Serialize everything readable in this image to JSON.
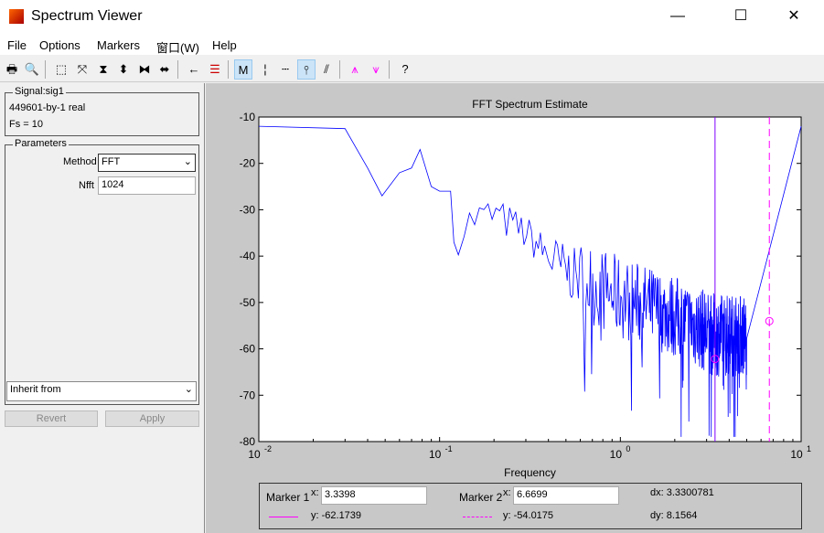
{
  "window": {
    "title": "Spectrum Viewer",
    "minimize": "—",
    "maximize": "☐",
    "close": "✕"
  },
  "menu": [
    "File",
    "Options",
    "Markers",
    "窗口(W)",
    "Help"
  ],
  "toolbar": [
    "printer-icon",
    "print-preview-icon",
    "zoom-box-icon",
    "zoom-out-icon",
    "vertical-zoom-in-icon",
    "vertical-zoom-out-icon",
    "horizontal-zoom-in-icon",
    "horizontal-zoom-out-icon",
    "select-signal-icon",
    "line-style-icon",
    "markers-on-off-icon",
    "vertical-markers-icon",
    "horizontal-markers-icon",
    "track-markers-icon",
    "slope-markers-icon",
    "peaks-icon",
    "valleys-icon",
    "whats-this-icon"
  ],
  "signal": {
    "legend": "Signal:sig1",
    "size": "449601-by-1 real",
    "fs": "Fs = 10"
  },
  "parameters": {
    "legend": "Parameters",
    "method_label": "Method",
    "method": "FFT",
    "nfft_label": "Nfft",
    "nfft": "1024",
    "inherit": "Inherit from",
    "revert": "Revert",
    "apply": "Apply"
  },
  "chart_data": {
    "type": "line",
    "title": "FFT Spectrum Estimate",
    "xlabel": "Frequency",
    "ylabel": "",
    "xscale": "log",
    "xlim": [
      0.01,
      10
    ],
    "ylim": [
      -80,
      -10
    ],
    "xticks": [
      "10",
      "10",
      "10",
      "10"
    ],
    "xtick_exp": [
      "-2",
      "-1",
      "0",
      "1"
    ],
    "yticks": [
      "-10",
      "-20",
      "-30",
      "-40",
      "-50",
      "-60",
      "-70",
      "-80"
    ],
    "color": "#0000ff",
    "grid": false,
    "trend": [
      [
        0.01,
        -12
      ],
      [
        0.03,
        -12.5
      ],
      [
        0.04,
        -21
      ],
      [
        0.048,
        -27
      ],
      [
        0.06,
        -22
      ],
      [
        0.07,
        -21
      ],
      [
        0.078,
        -17
      ],
      [
        0.09,
        -25
      ],
      [
        0.1,
        -26
      ],
      [
        0.115,
        -26
      ],
      [
        0.12,
        -37
      ],
      [
        0.15,
        -32
      ],
      [
        0.2,
        -31
      ],
      [
        0.3,
        -35
      ],
      [
        0.45,
        -42
      ],
      [
        0.6,
        -45
      ],
      [
        1,
        -49
      ],
      [
        2,
        -53
      ],
      [
        3.3,
        -57
      ],
      [
        5,
        -57
      ],
      [
        6.7,
        -54
      ],
      [
        8,
        -50
      ],
      [
        9.5,
        -38
      ],
      [
        10,
        -12
      ]
    ]
  },
  "markers": {
    "m1_label": "Marker 1",
    "m1_x_label": "x:",
    "m1_x": "3.3398",
    "m1_y": "y: -62.1739",
    "m2_label": "Marker 2",
    "m2_x_label": "x:",
    "m2_x": "6.6699",
    "m2_y": "y: -54.0175",
    "dx": "dx: 3.3300781",
    "dy": "dy: 8.1564",
    "color": "#ff00ff",
    "m1_line": "#8000ff"
  }
}
